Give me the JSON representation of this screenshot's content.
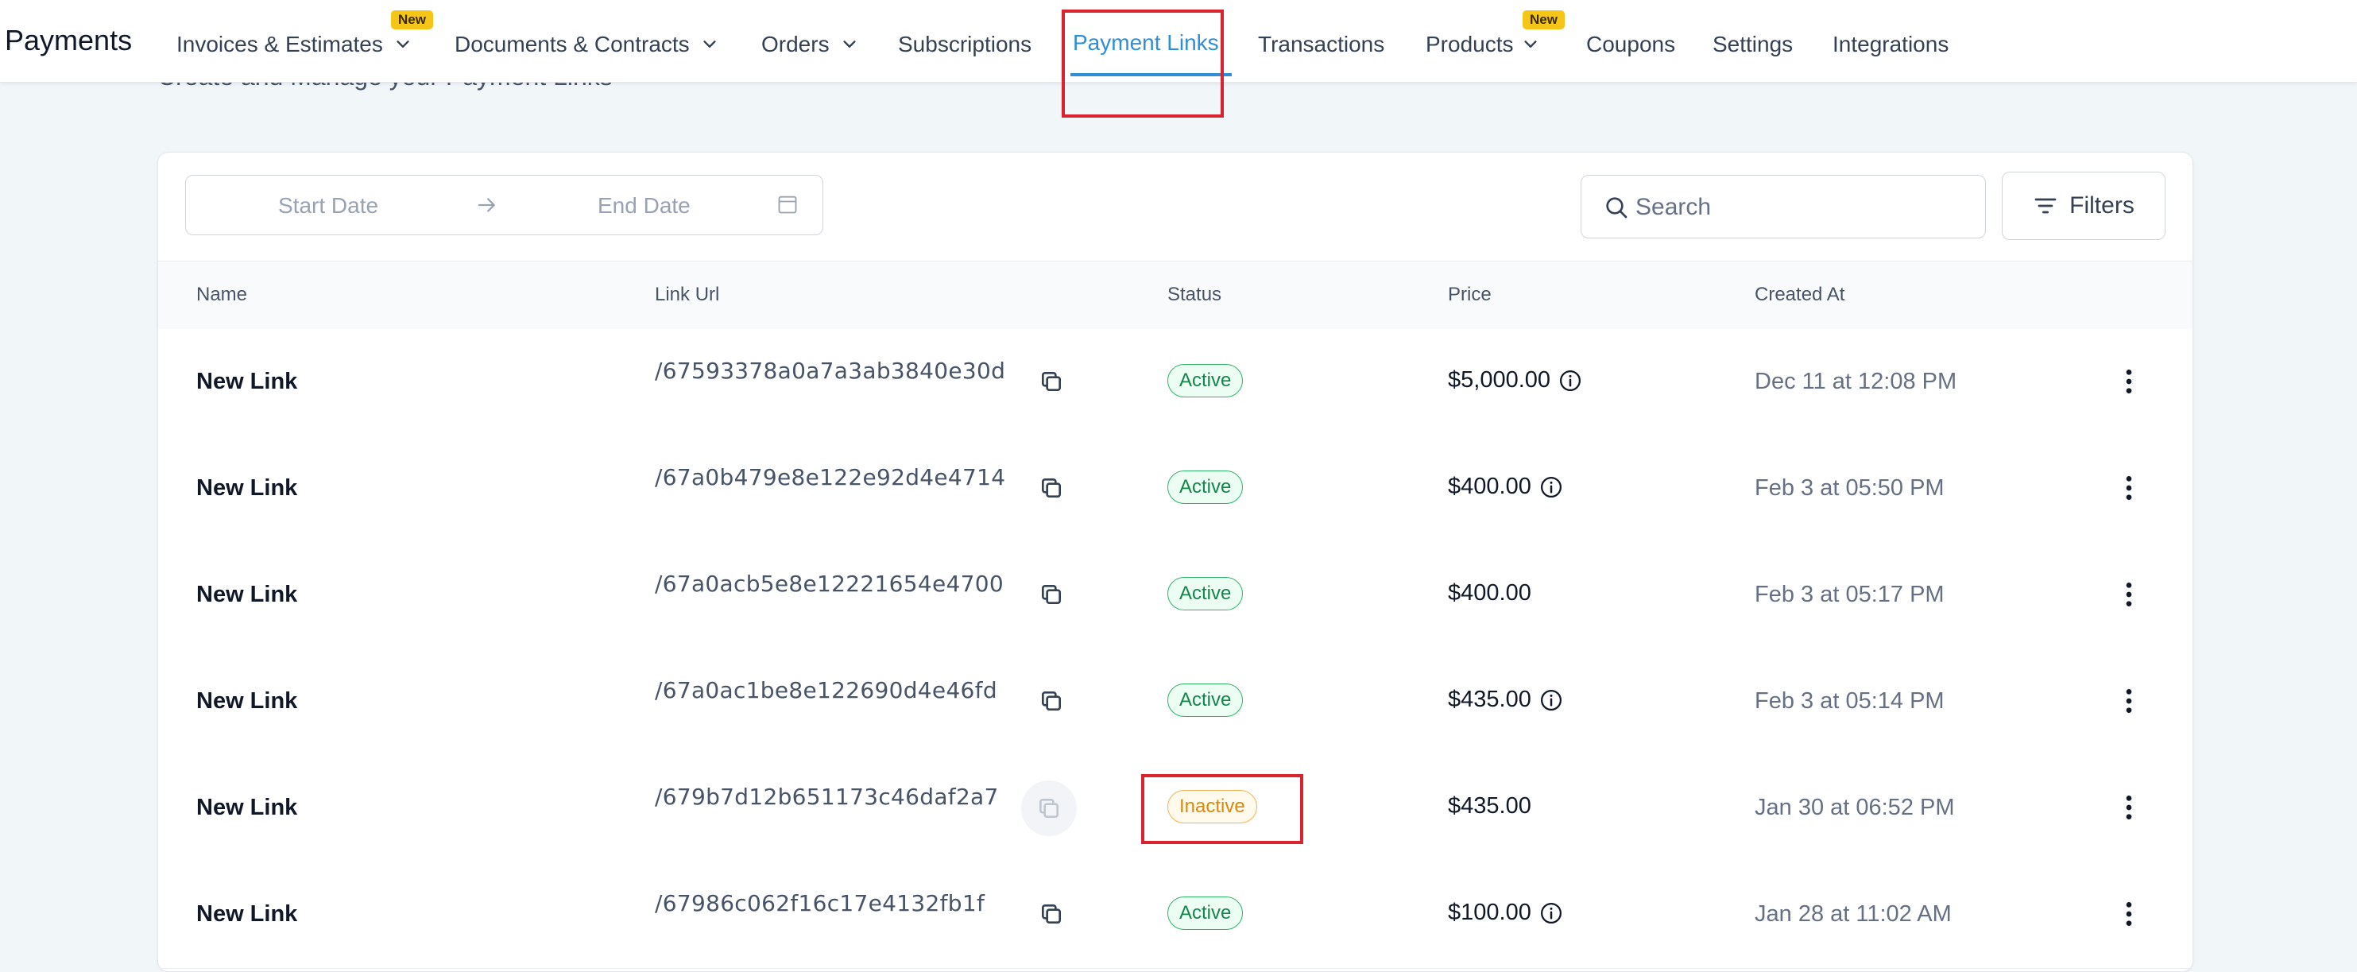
{
  "app": {
    "title": "Payments"
  },
  "nav": {
    "items": [
      {
        "label": "Invoices & Estimates",
        "badge": "New",
        "dropdown": true
      },
      {
        "label": "Documents & Contracts",
        "dropdown": true
      },
      {
        "label": "Orders",
        "dropdown": true
      },
      {
        "label": "Subscriptions"
      },
      {
        "label": "Payment Links",
        "active": true
      },
      {
        "label": "Transactions"
      },
      {
        "label": "Products",
        "badge": "New",
        "dropdown": true
      },
      {
        "label": "Coupons"
      },
      {
        "label": "Settings"
      },
      {
        "label": "Integrations"
      }
    ]
  },
  "page": {
    "subtitle": "Create and Manage your Payment Links"
  },
  "toolbar": {
    "start_date_placeholder": "Start Date",
    "end_date_placeholder": "End Date",
    "search_placeholder": "Search",
    "filters_label": "Filters"
  },
  "table": {
    "columns": [
      "Name",
      "Link Url",
      "Status",
      "Price",
      "Created At"
    ],
    "rows": [
      {
        "name": "New Link",
        "url": "/67593378a0a7a3ab3840e30d",
        "status": "Active",
        "price": "$5,000.00",
        "info": true,
        "created": "Dec 11 at 12:08 PM"
      },
      {
        "name": "New Link",
        "url": "/67a0b479e8e122e92d4e4714",
        "status": "Active",
        "price": "$400.00",
        "info": true,
        "created": "Feb 3 at 05:50 PM"
      },
      {
        "name": "New Link",
        "url": "/67a0acb5e8e12221654e4700",
        "status": "Active",
        "price": "$400.00",
        "info": false,
        "created": "Feb 3 at 05:17 PM"
      },
      {
        "name": "New Link",
        "url": "/67a0ac1be8e122690d4e46fd",
        "status": "Active",
        "price": "$435.00",
        "info": true,
        "created": "Feb 3 at 05:14 PM"
      },
      {
        "name": "New Link",
        "url": "/679b7d12b651173c46daf2a7",
        "status": "Inactive",
        "price": "$435.00",
        "info": false,
        "created": "Jan 30 at 06:52 PM"
      },
      {
        "name": "New Link",
        "url": "/67986c062f16c17e4132fb1f",
        "status": "Active",
        "price": "$100.00",
        "info": true,
        "created": "Jan 28 at 11:02 AM"
      }
    ]
  },
  "colors": {
    "accent": "#2f8fd6",
    "active": "#13864a",
    "inactive": "#d88a0e",
    "highlight": "#d9232e",
    "badge": "#f5c518"
  },
  "icons": {
    "dropdown": "chevron-down-icon",
    "copy": "copy-icon",
    "info": "info-icon",
    "more": "kebab-menu-icon",
    "search": "search-icon",
    "filters": "filter-lines-icon",
    "calendar": "calendar-icon",
    "arrow": "arrow-right-icon"
  }
}
